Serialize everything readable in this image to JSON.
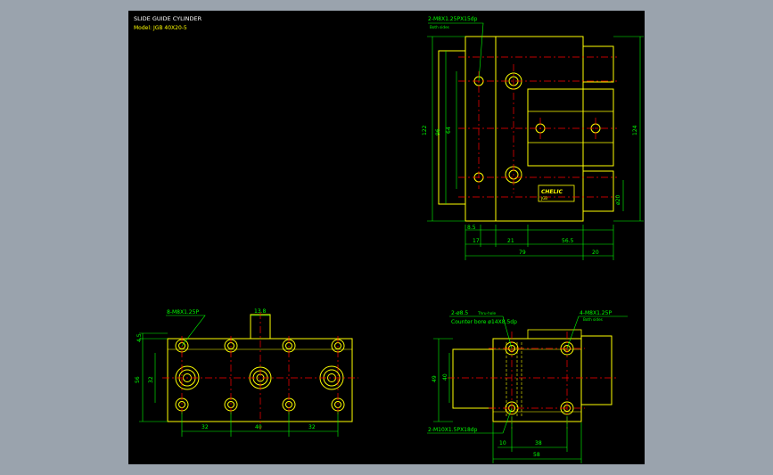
{
  "title_block": {
    "title": "SLIDE GUIDE CYLINDER",
    "model": "Model: JGB 40X20-5"
  },
  "side_view": {
    "callout_top": "2-M8X1.25PX15dp",
    "callout_top_note": "Both sides",
    "dims_vertical": [
      "122",
      "96",
      "64",
      "124",
      "ø20"
    ],
    "dims_horizontal": [
      "8.5",
      "17",
      "21",
      "56.5",
      "79",
      "20"
    ],
    "nameplate": "CHELIC",
    "nameplate_sub": "JGB"
  },
  "bottom_view": {
    "callout": "8-M8X1.25P",
    "dim_tab": "13.8",
    "dims_vertical": [
      "4.5",
      "56",
      "32"
    ],
    "dims_horizontal": [
      "32",
      "40",
      "32"
    ]
  },
  "end_view": {
    "callout_thru": "2-ø8.5",
    "callout_thru_note": "Thru-hole",
    "callout_counter": "Counter bore ø14X8.5dp",
    "callout_right": "4-M8X1.25P",
    "callout_right_note": "Both sides",
    "callout_bottom": "2-M10X1.5PX18dp",
    "dims_vertical": [
      "49",
      "40"
    ],
    "dims_horizontal": [
      "10",
      "38",
      "58"
    ]
  },
  "colors": {
    "background": "#9aa3ad",
    "canvas": "#000000",
    "outline": "#ffff00",
    "dimension": "#00ff00",
    "centerline": "#ff0000",
    "title_text": "#ffffff"
  }
}
